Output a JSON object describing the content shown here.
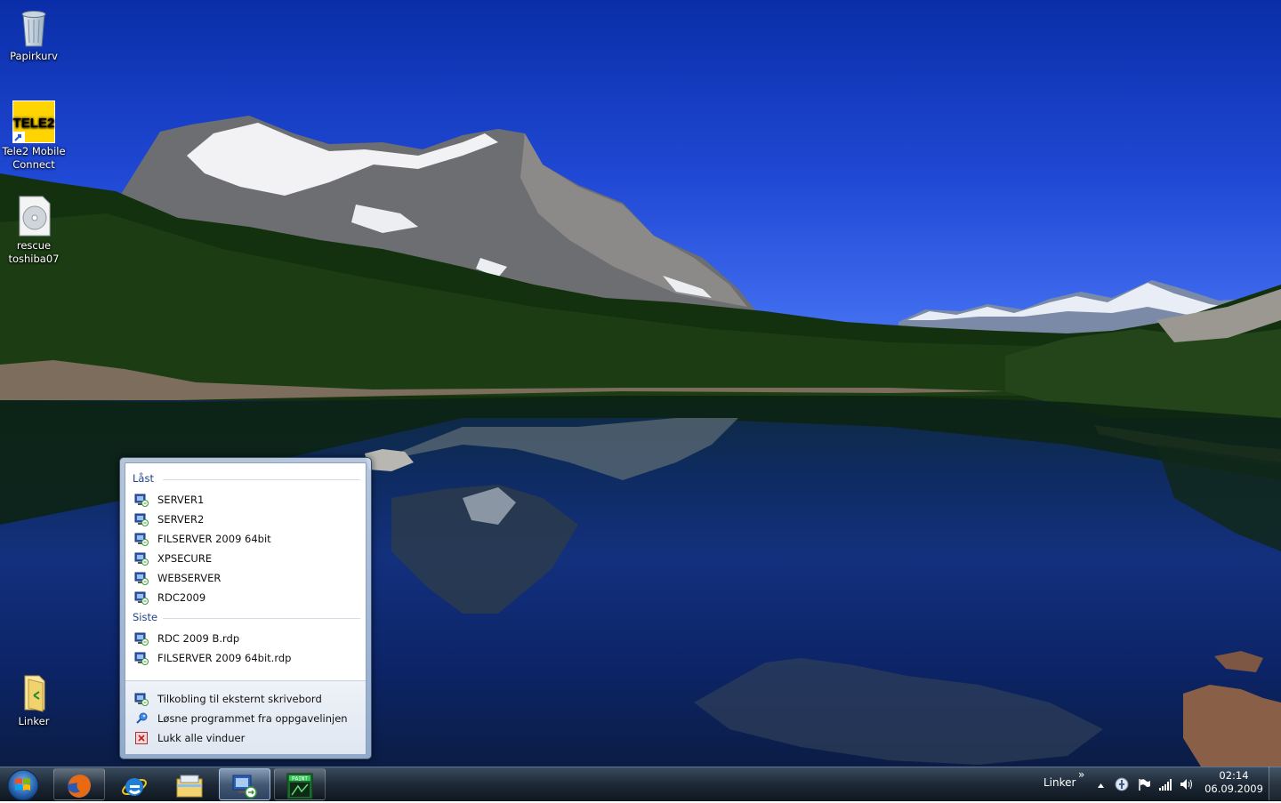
{
  "desktop": {
    "icons": [
      {
        "label": "Papirkurv"
      },
      {
        "label_line1": "Tele2 Mobile",
        "label_line2": "Connect",
        "logo_text": "TELE2"
      },
      {
        "label_line1": "rescue",
        "label_line2": "toshiba07"
      },
      {
        "label": "Linker"
      }
    ]
  },
  "jumplist": {
    "pinned_header": "Låst",
    "pinned": [
      "SERVER1",
      "SERVER2",
      "FILSERVER 2009 64bit",
      "XPSECURE",
      "WEBSERVER",
      "RDC2009"
    ],
    "recent_header": "Siste",
    "recent": [
      "RDC 2009 B.rdp",
      "FILSERVER 2009 64bit.rdp"
    ],
    "tasks": [
      {
        "label": "Tilkobling til eksternt skrivebord",
        "icon": "remote-desktop-icon"
      },
      {
        "label": "Løsne programmet fra oppgavelinjen",
        "icon": "unpin-icon"
      },
      {
        "label": "Lukk alle vinduer",
        "icon": "close-window-icon"
      }
    ]
  },
  "taskbar": {
    "apps": [
      {
        "icon": "firefox-icon"
      },
      {
        "icon": "internet-explorer-icon"
      },
      {
        "icon": "file-explorer-icon"
      },
      {
        "icon": "remote-desktop-icon",
        "active": true
      },
      {
        "icon": "paint-icon",
        "label": "PAINT"
      }
    ],
    "toolbar_label": "Linker",
    "toolbar_chevron": "»",
    "clock_time": "02:14",
    "clock_date": "06.09.2009"
  },
  "colors": {
    "jumplist_header": "#1e3f8a",
    "taskbar": "#14202e"
  }
}
